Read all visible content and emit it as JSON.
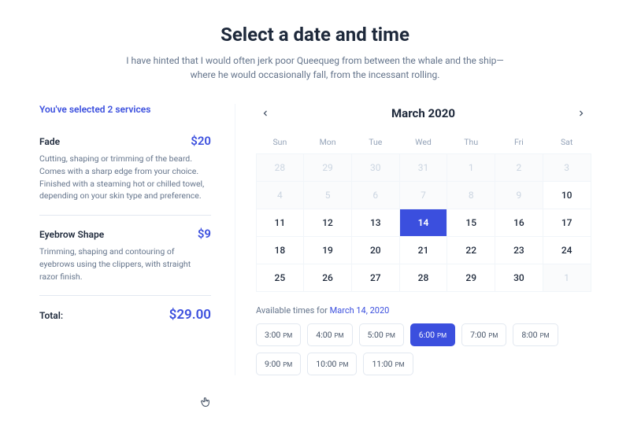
{
  "header": {
    "title": "Select a date and time",
    "subtitle": "I have hinted that I would often jerk poor Queequeg from between the whale and the ship—where he would occasionally fall, from the incessant rolling."
  },
  "sidebar": {
    "heading": "You've selected 2 services",
    "services": [
      {
        "name": "Fade",
        "price": "$20",
        "desc": "Cutting, shaping or trimming of the beard. Comes with a sharp edge from your choice. Finished with a steaming hot or chilled towel, depending on your skin type and preference."
      },
      {
        "name": "Eyebrow Shape",
        "price": "$9",
        "desc": "Trimming, shaping and contouring of eyebrows using the clippers, with straight razor finish."
      }
    ],
    "total_label": "Total:",
    "total_value": "$29.00"
  },
  "calendar": {
    "month_label": "March 2020",
    "dow": [
      "Sun",
      "Mon",
      "Tue",
      "Wed",
      "Thu",
      "Fri",
      "Sat"
    ],
    "days": [
      {
        "n": "28",
        "t": "other"
      },
      {
        "n": "29",
        "t": "other"
      },
      {
        "n": "30",
        "t": "other"
      },
      {
        "n": "31",
        "t": "other"
      },
      {
        "n": "1",
        "t": "other"
      },
      {
        "n": "2",
        "t": "other"
      },
      {
        "n": "3",
        "t": "other"
      },
      {
        "n": "4",
        "t": "other"
      },
      {
        "n": "5",
        "t": "other"
      },
      {
        "n": "6",
        "t": "other"
      },
      {
        "n": "7",
        "t": "other"
      },
      {
        "n": "8",
        "t": "other"
      },
      {
        "n": "9",
        "t": "other"
      },
      {
        "n": "10",
        "t": "curr"
      },
      {
        "n": "11",
        "t": "curr"
      },
      {
        "n": "12",
        "t": "curr"
      },
      {
        "n": "13",
        "t": "curr"
      },
      {
        "n": "14",
        "t": "sel"
      },
      {
        "n": "15",
        "t": "curr"
      },
      {
        "n": "16",
        "t": "curr"
      },
      {
        "n": "17",
        "t": "curr"
      },
      {
        "n": "18",
        "t": "curr"
      },
      {
        "n": "19",
        "t": "curr"
      },
      {
        "n": "20",
        "t": "curr"
      },
      {
        "n": "21",
        "t": "curr"
      },
      {
        "n": "22",
        "t": "curr"
      },
      {
        "n": "23",
        "t": "curr"
      },
      {
        "n": "24",
        "t": "curr"
      },
      {
        "n": "25",
        "t": "curr"
      },
      {
        "n": "26",
        "t": "curr"
      },
      {
        "n": "27",
        "t": "curr"
      },
      {
        "n": "28",
        "t": "curr"
      },
      {
        "n": "29",
        "t": "curr"
      },
      {
        "n": "30",
        "t": "curr"
      },
      {
        "n": "1",
        "t": "other"
      }
    ]
  },
  "availability": {
    "label_prefix": "Available times for ",
    "date_text": "March 14, 2020",
    "slots": [
      {
        "time": "3:00",
        "ampm": "PM",
        "selected": false
      },
      {
        "time": "4:00",
        "ampm": "PM",
        "selected": false
      },
      {
        "time": "5:00",
        "ampm": "PM",
        "selected": false
      },
      {
        "time": "6:00",
        "ampm": "PM",
        "selected": true
      },
      {
        "time": "7:00",
        "ampm": "PM",
        "selected": false
      },
      {
        "time": "8:00",
        "ampm": "PM",
        "selected": false
      },
      {
        "time": "9:00",
        "ampm": "PM",
        "selected": false
      },
      {
        "time": "10:00",
        "ampm": "PM",
        "selected": false
      },
      {
        "time": "11:00",
        "ampm": "PM",
        "selected": false
      }
    ]
  },
  "colors": {
    "accent": "#3b4fde"
  }
}
